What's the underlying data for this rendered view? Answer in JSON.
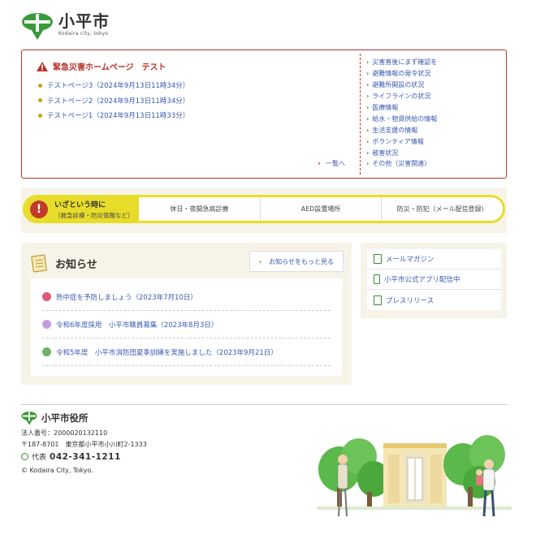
{
  "header": {
    "title": "小平市",
    "subtitle": "Kodaira city, tokyo"
  },
  "disaster": {
    "title": "緊急災害ホームページ　テスト",
    "news": [
      "テストページ3（2024年9月13日11時34分）",
      "テストページ2（2024年9月13日11時34分）",
      "テストページ1（2024年9月13日11時33分）"
    ],
    "list_link": "一覧へ",
    "links": [
      "災害直後にまず確認を",
      "避難情報の発令状況",
      "避難所開設の状況",
      "ライフラインの状況",
      "医療情報",
      "給水・物資供給の情報",
      "生活支援の情報",
      "ボランティア情報",
      "被害状況",
      "その他（災害関連）"
    ]
  },
  "emergency": {
    "head_title": "いざという時に",
    "head_sub": "（救急診療・防災情報など）",
    "items": [
      "休日・夜間急病診療",
      "AED設置場所",
      "防災・防犯（メール配信登録）"
    ]
  },
  "notice": {
    "title": "お知らせ",
    "more": "お知らせをもっと見る",
    "items": [
      {
        "text": "熱中症を予防しましょう（2023年7月10日）",
        "color": "#e05a7a"
      },
      {
        "text": "令和6年度採用　小平市職員募集（2023年8月3日）",
        "color": "#b07ad0"
      },
      {
        "text": "令和5年度　小平市消防団夏季訓練を実施しました（2023年9月21日）",
        "color": "#3a8a3a"
      }
    ]
  },
  "side_links": [
    "メールマガジン",
    "小平市公式アプリ配信中",
    "プレスリリース"
  ],
  "footer": {
    "name": "小平市役所",
    "corp_no": "法人番号：2000020132110",
    "address": "〒187-8701　東京都小平市小川町2-1333",
    "phone_label": "代表",
    "phone": "042-341-1211",
    "copyright": "© Kodaira City, Tokyo."
  },
  "colors": {
    "brand_green": "#3a8a3a",
    "alert_red": "#b8342a",
    "link_blue": "#3a5ab0",
    "emergency_yellow": "#e8dc2a"
  }
}
